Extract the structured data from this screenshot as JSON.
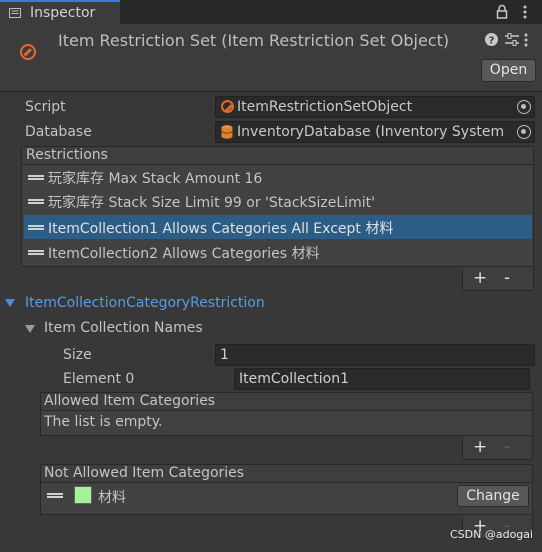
{
  "tab": {
    "label": "Inspector"
  },
  "header": {
    "title": "Item Restriction Set (Item Restriction Set Object)",
    "open_label": "Open"
  },
  "fields": {
    "script_label": "Script",
    "script_value": "ItemRestrictionSetObject",
    "database_label": "Database",
    "database_value": "InventoryDatabase (Inventory System D"
  },
  "restrictions": {
    "header": "Restrictions",
    "items": [
      "玩家库存  Max Stack Amount 16",
      "玩家库存 Stack Size Limit 99 or 'StackSizeLimit'",
      "ItemCollection1  Allows Categories All Except 材料",
      "ItemCollection2  Allows Categories 材料"
    ],
    "selected_index": 2
  },
  "detail": {
    "section_title": "ItemCollectionCategoryRestriction",
    "names_label": "Item Collection Names",
    "size_label": "Size",
    "size_value": "1",
    "element0_label": "Element 0",
    "element0_value": "ItemCollection1",
    "allowed_header": "Allowed Item Categories",
    "allowed_empty": "The list is empty.",
    "not_allowed_header": "Not Allowed Item Categories",
    "not_allowed_item": "材料",
    "not_allowed_color": "#a6f09a",
    "change_label": "Change"
  },
  "controls": {
    "plus": "+",
    "minus": "-"
  },
  "watermark": "CSDN @adogai",
  "colors": {
    "accent": "#3a7ae0",
    "selection": "#2c5d87",
    "section_title": "#5a9be6"
  }
}
